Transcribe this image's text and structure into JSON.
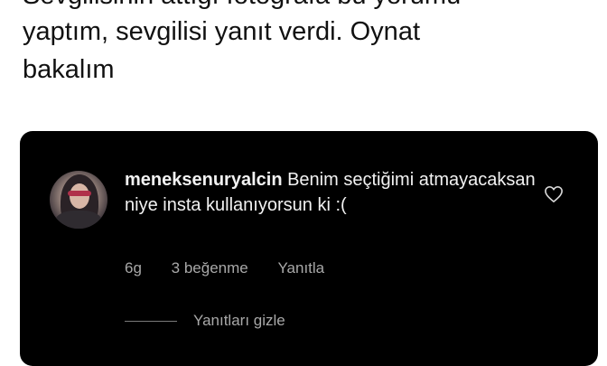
{
  "tweet": {
    "line_top_cut": "Sevgilisinin attığı fotoğrafa bu yorumu",
    "line1": "yaptım, sevgilisi yanıt verdi. Oynat",
    "line2": "bakalım"
  },
  "comment": {
    "username": "meneksenuryalcin",
    "text": "Benim seçtiğimi atmayacaksan niye insta kullanıyorsun ki :(",
    "time": "6g",
    "likes": "3 beğenme",
    "reply_label": "Yanıtla",
    "hide_replies_label": "Yanıtları gizle"
  },
  "icons": {
    "like": "heart-outline-icon",
    "avatar": "profile-photo"
  },
  "colors": {
    "card_bg": "#000000",
    "text_primary": "#f2f2f2",
    "text_secondary": "#a8a8a8"
  }
}
